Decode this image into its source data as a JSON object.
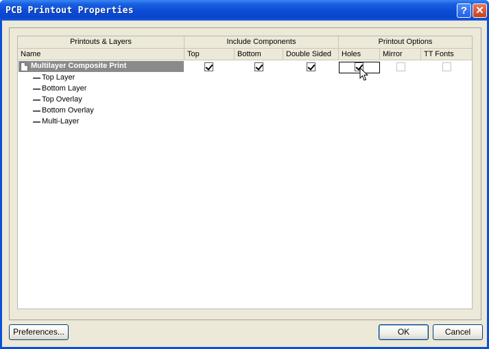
{
  "window": {
    "title": "PCB Printout Properties"
  },
  "title_buttons": {
    "help": "?",
    "close": "✕"
  },
  "grid": {
    "group_headers": [
      "Printouts & Layers",
      "Include Components",
      "Printout Options"
    ],
    "columns": [
      "Name",
      "Top",
      "Bottom",
      "Double Sided",
      "Holes",
      "Mirror",
      "TT Fonts"
    ],
    "printout": {
      "name": "Multilayer Composite Print",
      "top": true,
      "bottom": true,
      "double_sided": true,
      "holes": true,
      "mirror": false,
      "tt_fonts": false
    },
    "layers": [
      "Top Layer",
      "Bottom Layer",
      "Top Overlay",
      "Bottom Overlay",
      "Multi-Layer"
    ]
  },
  "buttons": {
    "preferences": "Preferences...",
    "ok": "OK",
    "cancel": "Cancel"
  },
  "icons": {
    "printout": "document-icon",
    "layer": "layer-line-icon",
    "cursor": "arrow-cursor-icon"
  },
  "colors": {
    "titlebar": "#0a4fd8",
    "dialog_bg": "#ece9d8",
    "selected_row": "#8a8a8a",
    "close_button": "#c7401c"
  }
}
